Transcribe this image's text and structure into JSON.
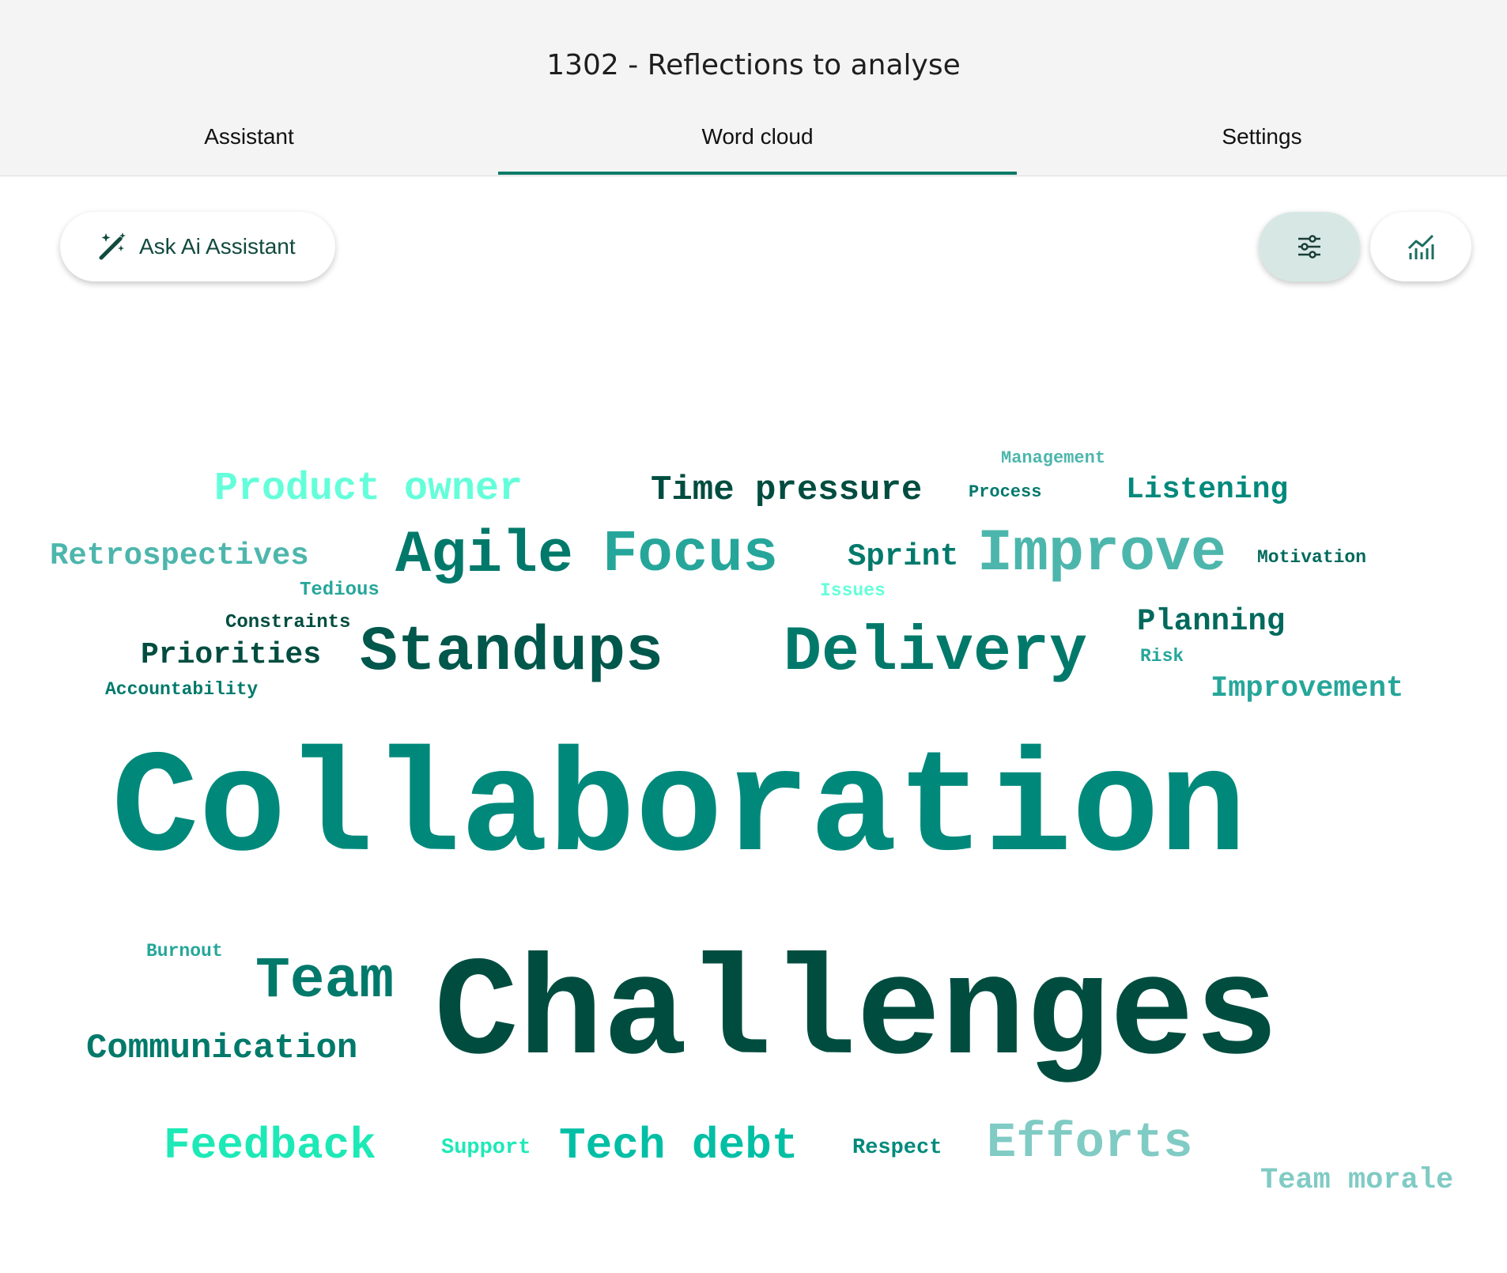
{
  "page": {
    "title": "1302 - Reflections to analyse"
  },
  "tabs": [
    {
      "label": "Assistant",
      "active": false
    },
    {
      "label": "Word cloud",
      "active": true
    },
    {
      "label": "Settings",
      "active": false
    }
  ],
  "toolbar": {
    "ask_label": "Ask Ai Assistant",
    "ask_icon": "magic-wand-icon",
    "filter_icon": "sliders-icon",
    "chart_icon": "chart-icon"
  },
  "colors": {
    "accent": "#0a7a67",
    "dark": "#004d40",
    "mid": "#00897b",
    "light": "#4db6ac",
    "pale": "#80cbc4",
    "bright": "#1de9b6",
    "aqua": "#64ffda"
  },
  "word_cloud": {
    "words": [
      {
        "text": "Management",
        "color": "#4db6ac"
      },
      {
        "text": "Product owner",
        "color": "#64ffda"
      },
      {
        "text": "Time pressure",
        "color": "#004d40"
      },
      {
        "text": "Process",
        "color": "#00796b"
      },
      {
        "text": "Listening",
        "color": "#00897b"
      },
      {
        "text": "Retrospectives",
        "color": "#4db6ac"
      },
      {
        "text": "Agile",
        "color": "#00796b"
      },
      {
        "text": "Focus",
        "color": "#26a69a"
      },
      {
        "text": "Sprint",
        "color": "#00796b"
      },
      {
        "text": "Improve",
        "color": "#4db6ac"
      },
      {
        "text": "Motivation",
        "color": "#00695c"
      },
      {
        "text": "Tedious",
        "color": "#26a69a"
      },
      {
        "text": "Issues",
        "color": "#64ffda"
      },
      {
        "text": "Constraints",
        "color": "#004d40"
      },
      {
        "text": "Planning",
        "color": "#00695c"
      },
      {
        "text": "Priorities",
        "color": "#004d40"
      },
      {
        "text": "Standups",
        "color": "#00574b"
      },
      {
        "text": "Delivery",
        "color": "#00796b"
      },
      {
        "text": "Risk",
        "color": "#26a69a"
      },
      {
        "text": "Accountability",
        "color": "#00796b"
      },
      {
        "text": "Improvement",
        "color": "#26a69a"
      },
      {
        "text": "Collaboration",
        "color": "#00897b"
      },
      {
        "text": "Burnout",
        "color": "#26a69a"
      },
      {
        "text": "Team",
        "color": "#00796b"
      },
      {
        "text": "Challenges",
        "color": "#004d40"
      },
      {
        "text": "Communication",
        "color": "#00796b"
      },
      {
        "text": "Feedback",
        "color": "#1de9b6"
      },
      {
        "text": "Support",
        "color": "#1de9b6"
      },
      {
        "text": "Tech debt",
        "color": "#00bfa5"
      },
      {
        "text": "Respect",
        "color": "#00897b"
      },
      {
        "text": "Efforts",
        "color": "#80cbc4"
      },
      {
        "text": "Team morale",
        "color": "#80cbc4"
      }
    ]
  }
}
